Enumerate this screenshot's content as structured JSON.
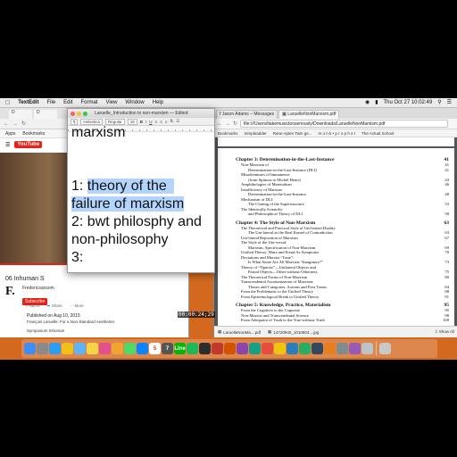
{
  "menubar": {
    "apple": "",
    "app_name": "TextEdit",
    "items": [
      "File",
      "Edit",
      "Format",
      "View",
      "Window",
      "Help"
    ],
    "clock": "Thu Oct 27  10:02:49",
    "user": "Tim"
  },
  "youtube": {
    "tabs": [
      "D",
      "D"
    ],
    "bookmarks": [
      "Apps",
      "Bookmarks"
    ],
    "logo": "YouTube",
    "video_title": "06 Inhuman S",
    "channel_name": "Fredericsansom",
    "subscribe_label": "Subscribe",
    "actions": [
      "Add to",
      "Share",
      "More"
    ],
    "published": "Published on Aug 10, 2015",
    "description": "François Laruelle: For a Non-Standard Aesthetics",
    "symposium": "Symposium Inhuman",
    "progress": 0.8
  },
  "textedit": {
    "title": "Laruelle_Introduction to non-marxism — Edited",
    "font_name": "Helvetica",
    "font_style": "Regular",
    "font_size": "18",
    "lines": {
      "heading": "marxism",
      "l1_num": "1: ",
      "l1_text": "theory of the",
      "l1b": "failure of marxism",
      "l2": "2: bwt philosphy and",
      "l2b": "non-philosophy",
      "l3": "3:"
    }
  },
  "pdf": {
    "tabs": [
      "Jason Adams – Messages",
      "LaruelleNonMarxism.pdf"
    ],
    "url": "file:///Users/itakemusictooseriously/Downloads/LaruelleNonMarxism.pdf",
    "bookmarks": [
      "Bookmarks",
      "Simpleadder",
      "Rane Aptes Twin ge...",
      "m o n k • p r o p h e t",
      "The Actual School"
    ],
    "toc": [
      {
        "level": 0,
        "title": "Chapter 3: Determination-in-the-Last-Instance",
        "page": "41"
      },
      {
        "level": 1,
        "title": "Non-Marxism of",
        "page": "41"
      },
      {
        "level": 2,
        "title": "Determination-in-the-Last-Instance (DLI)",
        "page": "41"
      },
      {
        "level": 1,
        "title": "Misadventures of Immanence",
        "page": ""
      },
      {
        "level": 2,
        "title": "(from Spinoza to Michel Henry)",
        "page": "43"
      },
      {
        "level": 1,
        "title": "Amphibologies of Materialism",
        "page": "46"
      },
      {
        "level": 1,
        "title": "Insufficiency of Marxian",
        "page": ""
      },
      {
        "level": 2,
        "title": "Determination-in-the-Last-Instance",
        "page": "48"
      },
      {
        "level": 1,
        "title": "Mechanism of DLI:",
        "page": ""
      },
      {
        "level": 2,
        "title": "The Cloning of the Superstructure",
        "page": "53"
      },
      {
        "level": 1,
        "title": "The Identically Scientific",
        "page": ""
      },
      {
        "level": 2,
        "title": "and Philosophical Theory of DLI",
        "page": "58"
      },
      {
        "level": 0,
        "title": "Chapter 4: The Style of Non-Marxism",
        "page": "63"
      },
      {
        "level": 1,
        "title": "The Theoretical and Practical Style of Uni-lateral Duality",
        "page": ""
      },
      {
        "level": 2,
        "title": "The Uni-lateral as the Real Kernel of Contradiction",
        "page": "63"
      },
      {
        "level": 1,
        "title": "Uni-lateral Reposition of Marxism",
        "page": "67"
      },
      {
        "level": 1,
        "title": "The Style of the Uni-versal:",
        "page": ""
      },
      {
        "level": 2,
        "title": "Marxism, Specification of Non-Marxism",
        "page": "69"
      },
      {
        "level": 1,
        "title": "Unified Theory: Marx and Freud As Symptoms",
        "page": "70"
      },
      {
        "level": 1,
        "title": "Deviations and Marxist “Taste”:",
        "page": ""
      },
      {
        "level": 2,
        "title": "Is What Some Are All Marxists “Imaginary?”",
        "page": "73"
      },
      {
        "level": 1,
        "title": "Theory of “Nparxis”—Unilateral Objects and",
        "page": ""
      },
      {
        "level": 2,
        "title": "Partial Objects—Other-without-Otherness",
        "page": "75"
      },
      {
        "level": 1,
        "title": "The Theoretical Forms of Non-Marxism",
        "page": "80"
      },
      {
        "level": 1,
        "title": "Transcendental Axiomatization of Marxism:",
        "page": ""
      },
      {
        "level": 2,
        "title": "Theses and Categories, Axioms and First Terms",
        "page": "84"
      },
      {
        "level": 1,
        "title": "From the Problematic to the Unified Theory",
        "page": "88"
      },
      {
        "level": 1,
        "title": "From Epistemological Break to Unified Theory",
        "page": "91"
      },
      {
        "level": 0,
        "title": "Chapter 5: Knowledge, Practice, Materialism",
        "page": "95"
      },
      {
        "level": 1,
        "title": "From the Cognitive to the Cognoste",
        "page": "95"
      },
      {
        "level": 1,
        "title": "Non-Marxist and Transcendental Science",
        "page": "98"
      },
      {
        "level": 1,
        "title": "From Adequatio of Truth to the True-without Truth",
        "page": "100"
      }
    ],
    "downloads": [
      "LaruelleNonMa....pdf",
      "14720940_1010804....jpg"
    ],
    "show_all": "Show All"
  },
  "timecode": "00:00:24;29",
  "dock_icons": [
    {
      "name": "finder-icon",
      "color": "#3d8ef7",
      "label": ""
    },
    {
      "name": "launchpad-icon",
      "color": "#8a8a8a",
      "label": ""
    },
    {
      "name": "safari-icon",
      "color": "#2a9df4",
      "label": ""
    },
    {
      "name": "chrome-icon",
      "color": "#f3c018",
      "label": ""
    },
    {
      "name": "mail-icon",
      "color": "#5bb4f5",
      "label": ""
    },
    {
      "name": "notes-icon",
      "color": "#f5d547",
      "label": ""
    },
    {
      "name": "itunes-icon",
      "color": "#e44f8d",
      "label": ""
    },
    {
      "name": "photos-icon",
      "color": "#f0a530",
      "label": ""
    },
    {
      "name": "messages-icon",
      "color": "#4cd964",
      "label": ""
    },
    {
      "name": "app-store-icon",
      "color": "#0a84ff",
      "label": ""
    },
    {
      "name": "calendar-icon",
      "color": "#ffffff",
      "label": "5"
    },
    {
      "name": "system-prefs-icon",
      "color": "#555555",
      "label": "7"
    },
    {
      "name": "line-icon",
      "color": "#00b900",
      "label": "Line"
    },
    {
      "name": "spotify-icon",
      "color": "#1db954",
      "label": ""
    },
    {
      "name": "app-icon-1",
      "color": "#2e2e2e",
      "label": ""
    },
    {
      "name": "app-icon-2",
      "color": "#c0392b",
      "label": ""
    },
    {
      "name": "app-icon-3",
      "color": "#d35400",
      "label": ""
    },
    {
      "name": "app-icon-4",
      "color": "#8e44ad",
      "label": ""
    },
    {
      "name": "app-icon-5",
      "color": "#16a085",
      "label": ""
    },
    {
      "name": "app-icon-6",
      "color": "#e74c3c",
      "label": ""
    },
    {
      "name": "app-icon-7",
      "color": "#f1c40f",
      "label": ""
    },
    {
      "name": "app-icon-8",
      "color": "#2980b9",
      "label": ""
    },
    {
      "name": "app-icon-9",
      "color": "#27ae60",
      "label": ""
    },
    {
      "name": "app-icon-10",
      "color": "#34495e",
      "label": ""
    },
    {
      "name": "app-icon-11",
      "color": "#e67e22",
      "label": ""
    },
    {
      "name": "app-icon-12",
      "color": "#7f8c8d",
      "label": ""
    },
    {
      "name": "app-icon-13",
      "color": "#9b59b6",
      "label": ""
    },
    {
      "name": "app-icon-14",
      "color": "#bdc3c7",
      "label": ""
    },
    {
      "name": "trash-icon",
      "color": "#c8c8c8",
      "label": ""
    }
  ]
}
